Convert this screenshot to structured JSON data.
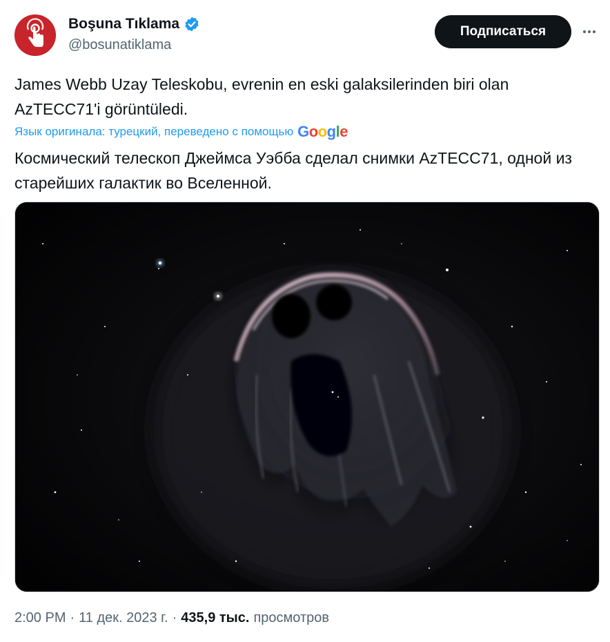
{
  "author": {
    "name": "Boşuna Tıklama",
    "handle": "@bosunatiklama",
    "verified": true,
    "avatar_color": "#c8242b",
    "avatar_icon": "tap-hand-icon"
  },
  "actions": {
    "subscribe_label": "Подписаться",
    "more_icon": "more-dots-icon"
  },
  "tweet": {
    "original_text": "James Webb Uzay Teleskobu, evrenin en eski galaksilerinden biri olan AzTECC71'i görüntüledi.",
    "translation_note": "Язык оригинала: турецкий, переведено с помощью",
    "translation_provider": "Google",
    "translated_text": "Космический телескоп Джеймса Уэбба сделал снимки AzTECC71, одной из старейших галактик во Вселенной."
  },
  "media": {
    "alt": "ghost-like nebula"
  },
  "meta": {
    "time": "2:00 PM",
    "sep1": "·",
    "date": "11 дек. 2023 г.",
    "sep2": "·",
    "views_count": "435,9 тыс.",
    "views_label": "просмотров"
  },
  "colors": {
    "accent": "#1d9bf0",
    "text": "#0f1419",
    "muted": "#536471",
    "button_bg": "#0f1419"
  }
}
